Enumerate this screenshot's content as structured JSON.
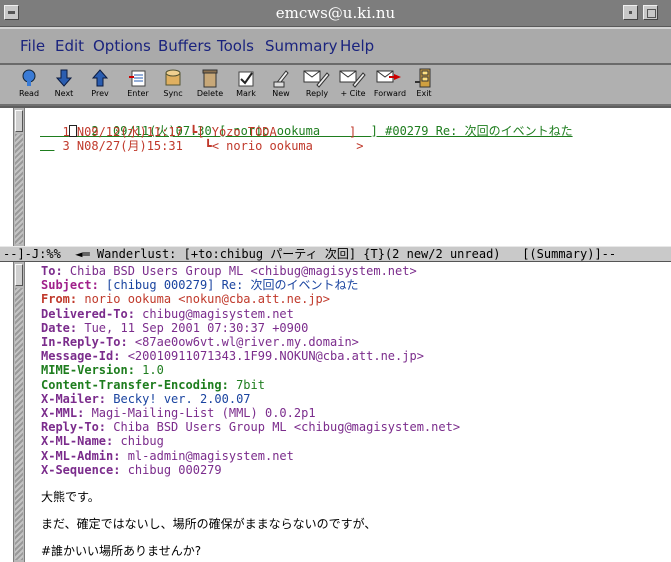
{
  "window": {
    "title": "emcws@u.ki.nu"
  },
  "menu": [
    "File",
    "Edit",
    "Options",
    "Buffers",
    "Tools",
    "Summary",
    "Help"
  ],
  "toolbar": [
    {
      "label": "Read",
      "icon": "read-icon"
    },
    {
      "label": "Next",
      "icon": "next-arrow-icon"
    },
    {
      "label": "Prev",
      "icon": "prev-arrow-icon"
    },
    {
      "label": "Enter",
      "icon": "enter-folder-icon"
    },
    {
      "label": "Sync",
      "icon": "sync-icon"
    },
    {
      "label": "Delete",
      "icon": "trash-icon"
    },
    {
      "label": "Mark",
      "icon": "mark-icon"
    },
    {
      "label": "New",
      "icon": "new-message-icon"
    },
    {
      "label": "Reply",
      "icon": "reply-icon"
    },
    {
      "label": "+ Cite",
      "icon": "cite-icon"
    },
    {
      "label": "Forward",
      "icon": "forward-icon"
    },
    {
      "label": "Exit",
      "icon": "exit-icon"
    }
  ],
  "summary": {
    "row1": "  2  09/11(火)07:30 [ norio ookuma       ] #00279 Re: 次回のイベントねた",
    "row2": "  1 N09/12(水)11:17 ┗[ Yozo TODA          ]",
    "row3": "  3 N08/27(月)15:31   ┗< norio ookuma      >"
  },
  "modeline": "--]-J:%%  ◄═ Wanderlust: [+to:chibug パーティ 次回] {T}(2 new/2 unread)   [(Summary)]--",
  "headers": [
    {
      "key": "To:",
      "value": " Chiba BSD Users Group ML <chibug@magisystem.net>",
      "kclass": "c-purple",
      "vclass": "c-purple"
    },
    {
      "key": "Subject:",
      "value": " [chibug 000279] Re: 次回のイベントねた",
      "kclass": "c-mag",
      "vclass": "c-blue"
    },
    {
      "key": "From:",
      "value": " norio ookuma <nokun@cba.att.ne.jp>",
      "kclass": "c-red",
      "vclass": "c-red"
    },
    {
      "key": "Delivered-To:",
      "value": " chibug@magisystem.net",
      "kclass": "c-purple",
      "vclass": "c-purple"
    },
    {
      "key": "Date:",
      "value": " Tue, 11 Sep 2001 07:30:37 +0900",
      "kclass": "c-purple",
      "vclass": "c-purple"
    },
    {
      "key": "In-Reply-To:",
      "value": " <87ae0ow6vt.wl@river.my.domain>",
      "kclass": "c-purple",
      "vclass": "c-purple"
    },
    {
      "key": "Message-Id:",
      "value": " <20010911071343.1F99.NOKUN@cba.att.ne.jp>",
      "kclass": "c-purple",
      "vclass": "c-purple"
    },
    {
      "key": "MIME-Version:",
      "value": " 1.0",
      "kclass": "c-green-b",
      "vclass": "c-green"
    },
    {
      "key": "Content-Transfer-Encoding:",
      "value": " 7bit",
      "kclass": "c-green-b",
      "vclass": "c-green"
    },
    {
      "key": "X-Mailer:",
      "value": " Becky! ver. 2.00.07",
      "kclass": "c-purple",
      "vclass": "c-blue"
    },
    {
      "key": "X-MML:",
      "value": " Magi-Mailing-List (MML) 0.0.2p1",
      "kclass": "c-purple",
      "vclass": "c-purple"
    },
    {
      "key": "Reply-To:",
      "value": " Chiba BSD Users Group ML <chibug@magisystem.net>",
      "kclass": "c-purple",
      "vclass": "c-purple"
    },
    {
      "key": "X-ML-Name:",
      "value": " chibug",
      "kclass": "c-purple",
      "vclass": "c-purple"
    },
    {
      "key": "X-ML-Admin:",
      "value": " ml-admin@magisystem.net",
      "kclass": "c-purple",
      "vclass": "c-purple"
    },
    {
      "key": "X-Sequence:",
      "value": " chibug 000279",
      "kclass": "c-purple",
      "vclass": "c-purple"
    }
  ],
  "body": [
    "大熊です。",
    "まだ、確定ではないし、場所の確保がままならないのですが、",
    "#誰かいい場所ありませんか?"
  ]
}
